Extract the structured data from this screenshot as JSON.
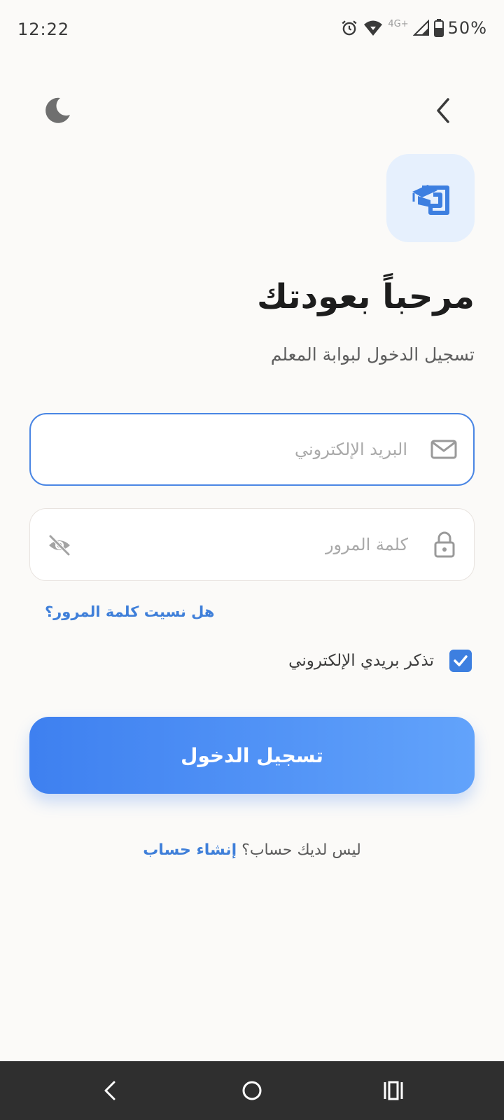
{
  "status_bar": {
    "time": "12:22",
    "network": "4G+",
    "battery": "50%",
    "icons": [
      "alarm-icon",
      "wifi-icon",
      "signal-icon",
      "battery-icon"
    ]
  },
  "header": {
    "theme_toggle_icon": "moon-icon",
    "back_icon": "chevron-left-icon"
  },
  "logo": {
    "icon": "graduation-cap-icon",
    "accent": "#3d7fe0",
    "background": "#e6f0fd"
  },
  "title": "مرحباً بعودتك",
  "subtitle": "تسجيل الدخول لبوابة المعلم",
  "email_field": {
    "placeholder": "البريد الإلكتروني",
    "value": "",
    "icon": "mail-icon"
  },
  "password_field": {
    "placeholder": "كلمة المرور",
    "value": "",
    "icon": "lock-icon",
    "visibility_icon": "eye-off-icon"
  },
  "forgot_password": "هل نسيت كلمة المرور؟",
  "remember_me": {
    "label": "تذكر بريدي الإلكتروني",
    "checked": true
  },
  "login_button": "تسجيل الدخول",
  "signup": {
    "question": "ليس لديك حساب؟",
    "link": "إنشاء حساب"
  },
  "nav_bar": {
    "icons": [
      "back-icon",
      "home-icon",
      "recents-icon"
    ]
  },
  "colors": {
    "accent": "#3d7fe0",
    "link": "#3f7fd9",
    "background": "#fbfaf8"
  }
}
